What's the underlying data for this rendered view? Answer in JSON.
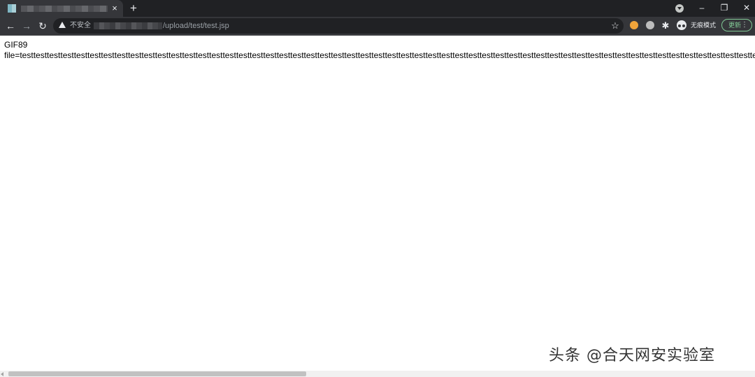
{
  "browser": {
    "tab": {
      "favicon": "blurred-favicon",
      "title_blurred": true,
      "close_label": "×"
    },
    "new_tab_label": "+",
    "window_controls": {
      "minimize": "–",
      "restore": "❐",
      "close": "✕"
    },
    "nav": {
      "back": "←",
      "forward": "→",
      "reload": "↻"
    },
    "address": {
      "security_label": "不安全",
      "host_blurred": true,
      "path": "/upload/test/test.jsp"
    },
    "bookmark_star": "☆",
    "extensions": [
      {
        "name": "cookie-extension",
        "color": "#f0a43a"
      },
      {
        "name": "grey-extension",
        "color": "#bdbdbd"
      }
    ],
    "puzzle": "✱",
    "incognito_label": "无痕模式",
    "update": {
      "label": "更新",
      "more": "⋮"
    }
  },
  "page": {
    "lines": [
      "GIF89",
      "file=testtesttesttesttesttesttesttesttesttesttesttesttesttesttesttesttesttesttesttesttesttesttesttesttesttesttesttesttesttesttesttesttesttesttesttesttesttesttesttesttesttesttesttesttesttesttesttesttesttesttesttesttesttesttesttesttesttesttesttesttesttesttesttesttesttesttesttesttesttesttesttesttesttesttest"
    ]
  },
  "watermark": "头条 @合天网安实验室",
  "scrollbar": {
    "horizontal_thumb_fraction": 0.4
  }
}
